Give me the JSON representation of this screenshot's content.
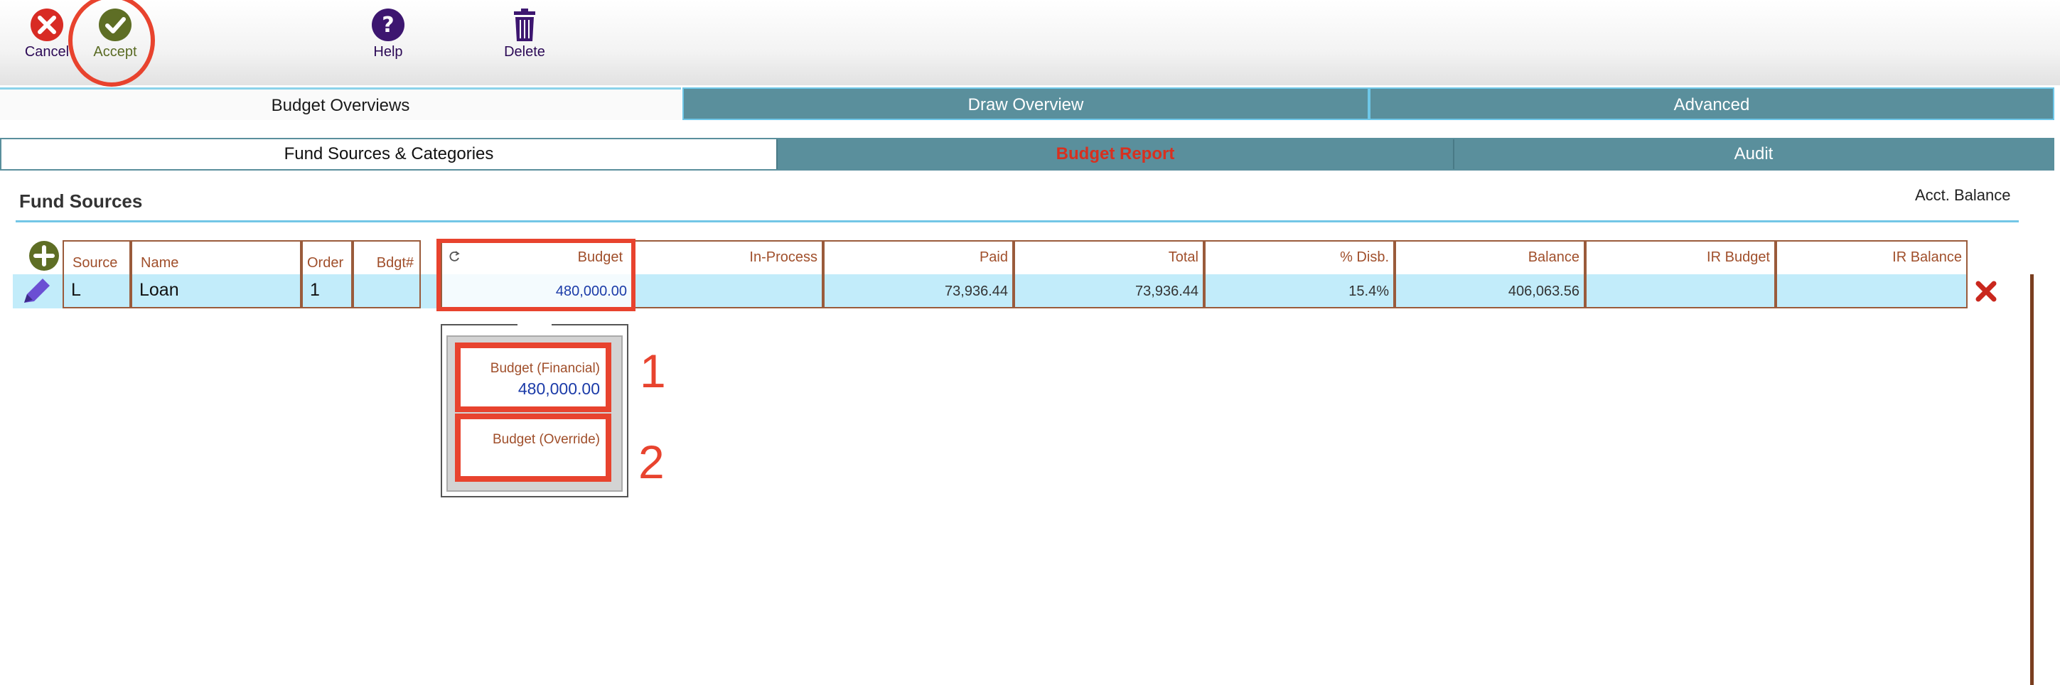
{
  "toolbar": {
    "cancel_label": "Cancel",
    "accept_label": "Accept",
    "help_label": "Help",
    "delete_label": "Delete"
  },
  "tabs_primary": [
    "Budget Overviews",
    "Draw Overview",
    "Advanced"
  ],
  "tabs_secondary": [
    "Fund Sources & Categories",
    "Budget Report",
    "Audit"
  ],
  "section": {
    "title": "Fund Sources",
    "acct_balance_label": "Acct. Balance"
  },
  "table": {
    "headers": {
      "source": "Source",
      "name": "Name",
      "order": "Order",
      "bdgt": "Bdgt#",
      "budget": "Budget",
      "in_process": "In-Process",
      "paid": "Paid",
      "total": "Total",
      "pct_disb": "% Disb.",
      "balance": "Balance",
      "ir_budget": "IR Budget",
      "ir_balance": "IR Balance"
    },
    "row": {
      "source": "L",
      "name": "Loan",
      "order": "1",
      "bdgt": "",
      "budget": "480,000.00",
      "in_process": "",
      "paid": "73,936.44",
      "total": "73,936.44",
      "pct_disb": "15.4%",
      "balance": "406,063.56",
      "ir_budget": "",
      "ir_balance": ""
    }
  },
  "popup": {
    "financial_label": "Budget (Financial)",
    "financial_value": "480,000.00",
    "override_label": "Budget (Override)",
    "override_value": ""
  },
  "annotations": {
    "marker_1": "1",
    "marker_2": "2"
  },
  "colors": {
    "accent_teal": "#5a8f9c",
    "highlight_red": "#e8432e",
    "header_text": "#a04f2b",
    "row_bg": "#c2ecfa"
  }
}
